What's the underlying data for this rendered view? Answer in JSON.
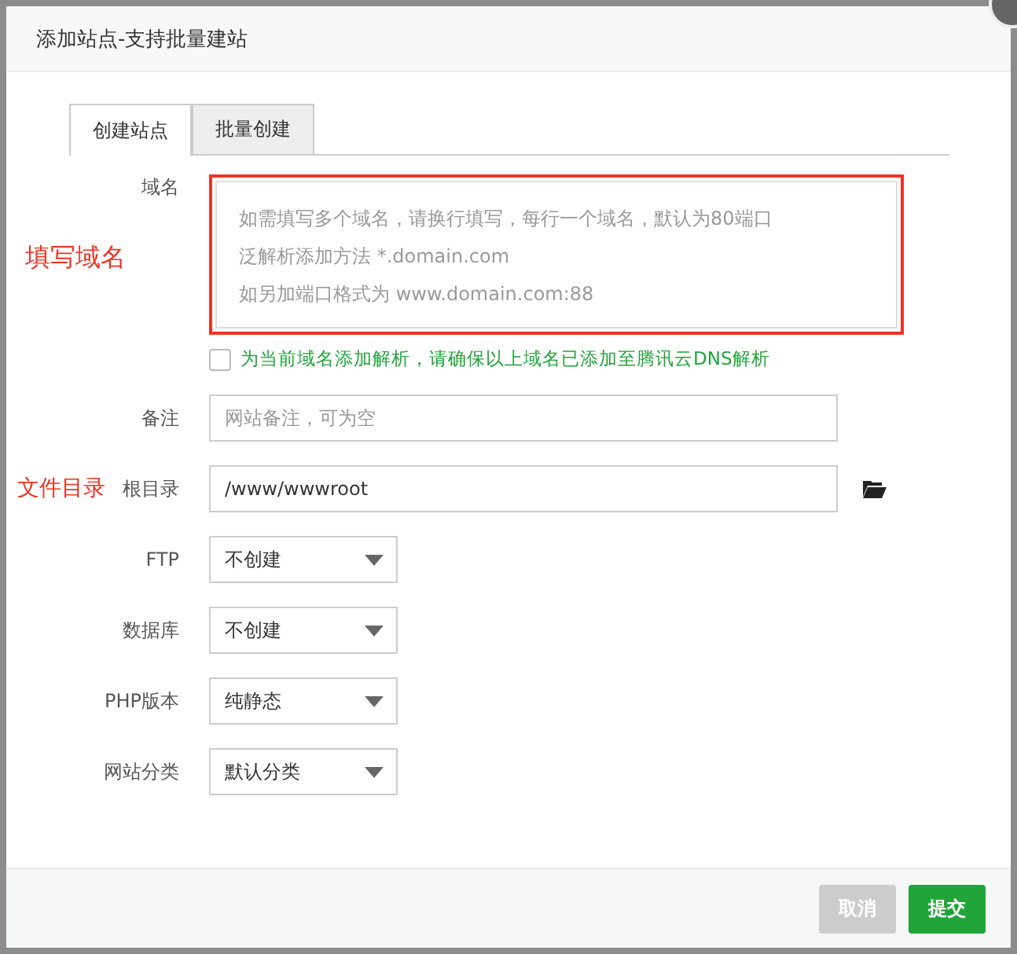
{
  "dialog": {
    "title": "添加站点-支持批量建站"
  },
  "tabs": [
    {
      "label": "创建站点",
      "selected": true
    },
    {
      "label": "批量创建",
      "selected": false
    }
  ],
  "domain": {
    "label": "域名",
    "annotation": "填写域名",
    "placeholder_lines": [
      "如需填写多个域名，请换行填写，每行一个域名，默认为80端口",
      "泛解析添加方法 *.domain.com",
      "如另加端口格式为 www.domain.com:88"
    ]
  },
  "dns_option": {
    "label": "为当前域名添加解析，请确保以上域名已添加至腾讯云DNS解析",
    "checked": false
  },
  "remark": {
    "label": "备注",
    "placeholder": "网站备注，可为空"
  },
  "root": {
    "label": "根目录",
    "annotation": "文件目录",
    "value": "/www/wwwroot"
  },
  "selects": [
    {
      "label": "FTP",
      "value": "不创建"
    },
    {
      "label": "数据库",
      "value": "不创建"
    },
    {
      "label": "PHP版本",
      "value": "纯静态"
    },
    {
      "label": "网站分类",
      "value": "默认分类"
    }
  ],
  "buttons": [
    {
      "label": "取消",
      "kind": "cancel"
    },
    {
      "label": "提交",
      "kind": "submit"
    }
  ]
}
